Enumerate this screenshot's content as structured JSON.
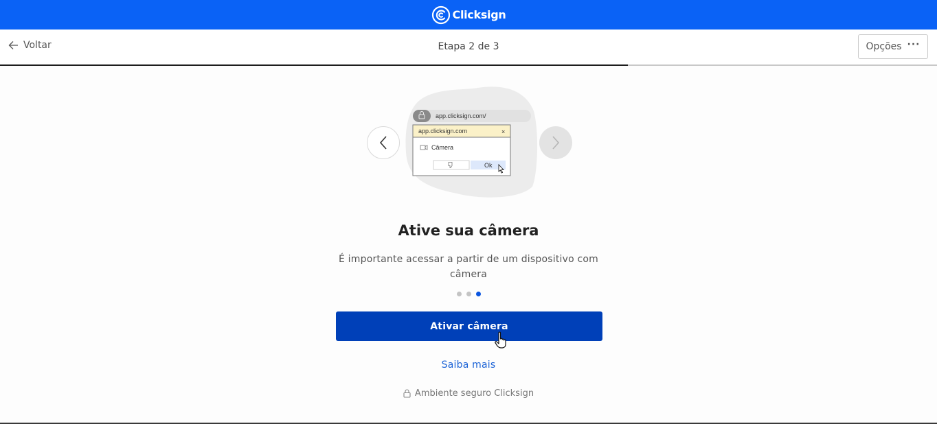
{
  "header": {
    "brand": "Clicksign",
    "brand_color": "#0a62f6"
  },
  "nav": {
    "back_label": "Voltar",
    "step_label": "Etapa 2 de 3",
    "options_label": "Opções",
    "options_icon": "more-horizontal-icon"
  },
  "progress": {
    "current_step": 2,
    "total_steps": 3,
    "fraction": 0.67
  },
  "illustration": {
    "url_bar": "app.clicksign.com/",
    "dialog_title": "app.clicksign.com",
    "dialog_close": "×",
    "dialog_item": "Câmera",
    "dialog_ok": "Ok"
  },
  "content": {
    "title": "Ative sua câmera",
    "description": "É importante acessar a partir de um dispositivo com câmera",
    "pager": {
      "count": 3,
      "active": 3
    },
    "primary_button": "Ativar câmera",
    "learn_more": "Saiba mais",
    "secure_note": "Ambiente seguro Clicksign"
  },
  "colors": {
    "primary_button": "#0040b8",
    "link": "#1a62d6",
    "active_dot": "#0a55e0"
  }
}
